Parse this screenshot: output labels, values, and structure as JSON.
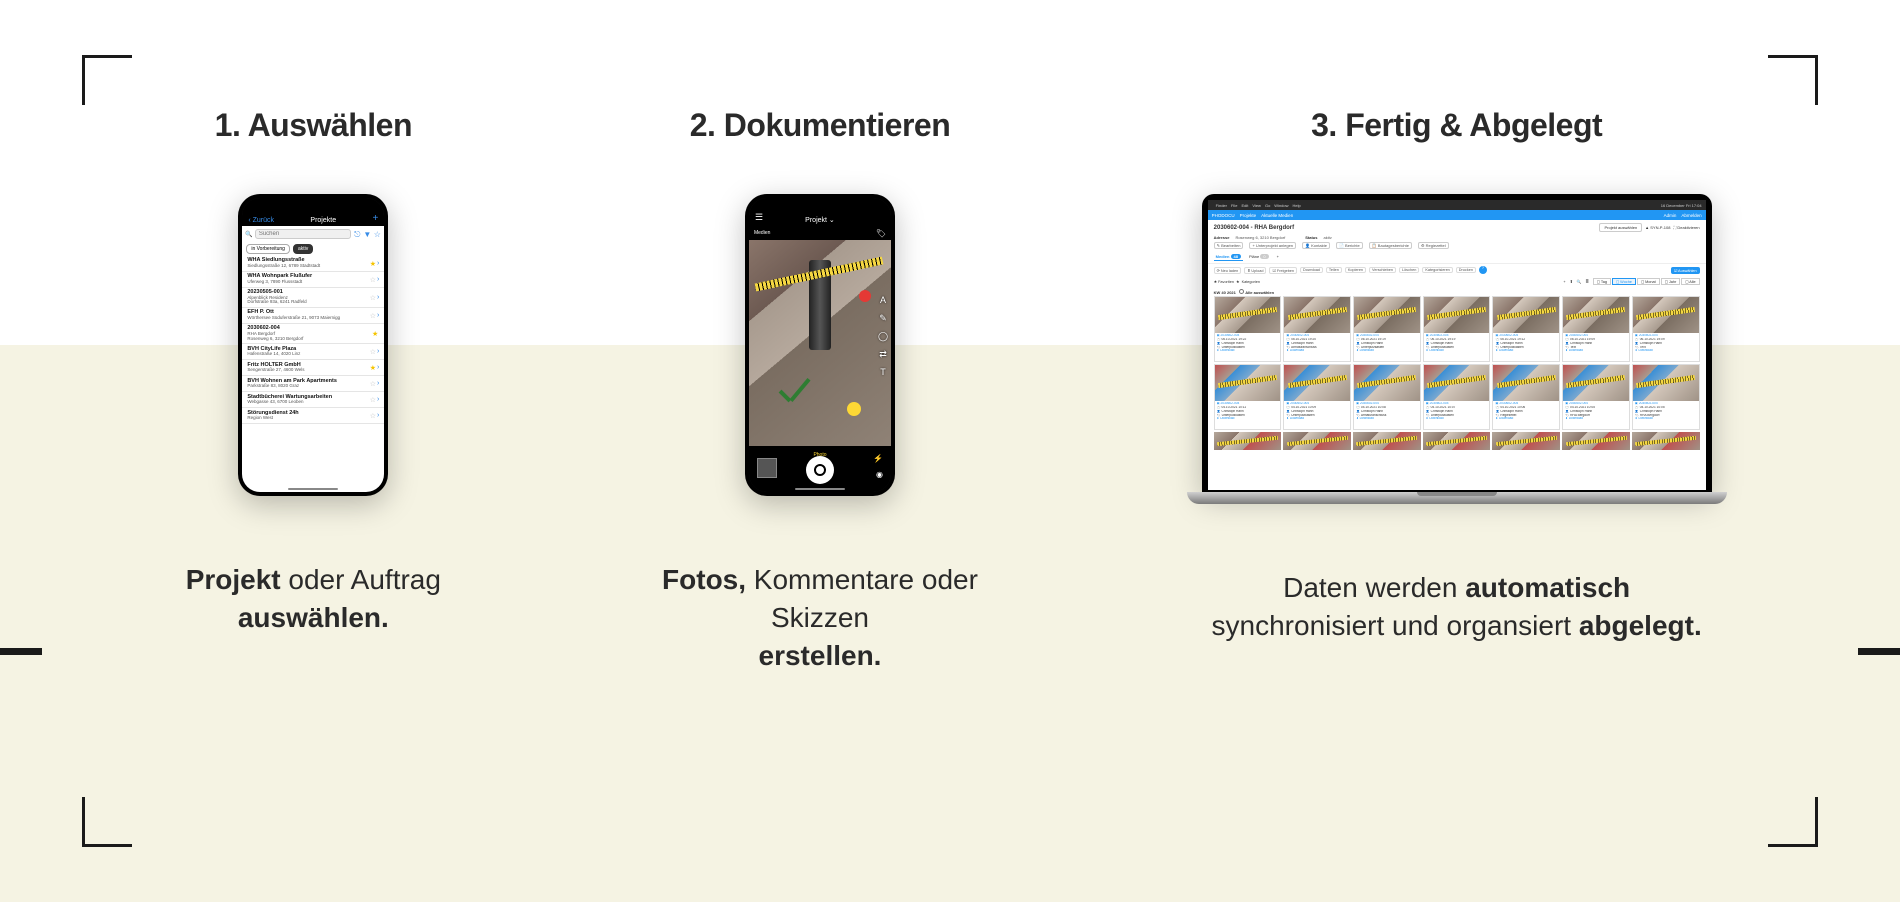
{
  "steps": {
    "s1": {
      "title": "1. Auswählen",
      "caption_bold1": "Projekt",
      "caption_plain1": " oder Auftrag ",
      "caption_bold2": "auswählen."
    },
    "s2": {
      "title": "2. Dokumentieren",
      "caption_bold1": "Fotos,",
      "caption_plain1": " Kommentare oder Skizzen ",
      "caption_bold2": "erstellen."
    },
    "s3": {
      "title": "3. Fertig & Abgelegt",
      "caption_plain1": "Daten werden ",
      "caption_bold1": "automatisch",
      "caption_plain2": " synchronisiert und organsiert ",
      "caption_bold2": "abgelegt."
    }
  },
  "phone1": {
    "back": "Zurück",
    "header_title": "Projekte",
    "plus": "+",
    "search_placeholder": "Suchen",
    "tabs": {
      "prep": "in Vorbereitung",
      "active": "aktiv"
    },
    "rows": [
      {
        "t1": "WHA Siedlungsstraße",
        "t2": "Siedlungsstraße 12, 6789 Stadtstadt",
        "star": true,
        "chev": true
      },
      {
        "t1": "WHA Wohnpark Flußufer",
        "t2": "Uferweg 3, 7890 Flussstadt",
        "star": false,
        "chev": true
      },
      {
        "t1": "20230505-001",
        "t2": "Alpenblick Residenz\nDorfstraße 93a, 6241 Radfeld",
        "star": false,
        "chev": true
      },
      {
        "t1": "EFH P. Ott",
        "t2": "Wörthersee Süduferstraße 21, 9073 Maiernigg",
        "star": false,
        "chev": true
      },
      {
        "t1": "2030602-004",
        "t2": "RHA Bergdorf\nRosenweg 6, 3210 Bergdorf",
        "star": true,
        "chev": false
      },
      {
        "t1": "BVH CityLife Plaza",
        "t2": "Hafenstraße 14, 4020 Linz",
        "star": false,
        "chev": true
      },
      {
        "t1": "Fritz HOLTER GmbH",
        "t2": "Sengerstraße 27, 4600 Wels",
        "star": true,
        "chev": true
      },
      {
        "t1": "BVH Wohnen am Park Apartments",
        "t2": "Parkstraße 83, 8020 Graz",
        "star": false,
        "chev": true
      },
      {
        "t1": "Stadtbücherei Wartungsarbeiten",
        "t2": "Webgasse 43, 6700 Leoben",
        "star": false,
        "chev": true
      },
      {
        "t1": "Störungsdienst 24h",
        "t2": "Region West",
        "star": false,
        "chev": true
      }
    ]
  },
  "phone2": {
    "header_title": "Projekt",
    "section_label": "Medien",
    "mode": "Photo",
    "tools": [
      "A",
      "✎",
      "◯",
      "⇄",
      "T"
    ]
  },
  "laptop": {
    "mac_menu_left": [
      "",
      "Finder",
      "File",
      "Edit",
      "View",
      "Go",
      "Window",
      "Help"
    ],
    "mac_menu_right": [
      "16 December Fri 17:04"
    ],
    "topbar_left": [
      "PHODOCU",
      "Projekte",
      "Aktuelle Medien"
    ],
    "topbar_right": [
      "Admin",
      "Abmelden"
    ],
    "project_title": "2030602-004 - RHA Bergdorf",
    "project_select": "Projekt auswählen",
    "project_meta1": "▲ SYN-P-108",
    "project_meta2": "⛶ Deaktivieren",
    "sub_label_addr": "Adresse",
    "sub_addr": "Rosenweg 6, 3210 Bergdorf",
    "sub_label_status": "Status",
    "sub_status": "aktiv",
    "sub_btns": [
      "✎ Bearbeiten",
      "+ Unterprojekt anlegen",
      "👤 Kontakte",
      "📄 Berichte",
      "📋 Bautagesberichte",
      "⚙ Regiezettel"
    ],
    "tab_media": "Medien",
    "tab_media_count": "48",
    "tab_plane": "Pläne",
    "tab_plane_count": "0",
    "tab_plus": "+",
    "actionbar": [
      "⟳ Neu laden",
      "⬆ Upload",
      "☑ Freigeben",
      "Download",
      "Teilen",
      "Kopieren",
      "Verschieben",
      "Löschen",
      "Kategorisieren",
      "Drucken"
    ],
    "actionbar_btn": "☑ Auswählen",
    "filter_star": "★",
    "filter_fav": "Favoriten",
    "filter_cat": "Kategorien",
    "filter_modes": [
      "Tag",
      "Woche",
      "Monat",
      "Jahr",
      "Alle"
    ],
    "kw_label": "KW 40 2021",
    "kw_check": "Alle auswählen",
    "card_proj": "▣ 2030602-004",
    "card_date": "🕐 06.10.2021 19:22",
    "card_user": "👤 Christoph Hahn",
    "card_note1": "🏷 Unterputzkasten",
    "card_note2": "🏷 Armaturanschluss",
    "card_note3": "🏷 RHA Bergdorf",
    "card_note4": "🏷 Regiezettel",
    "card_note_gen": "🏷 Text",
    "card_dl": "⬇ Download",
    "card_dates": [
      "06.10.2021 19:22",
      "06.10.2021 19:20",
      "06.10.2021 19:19",
      "06.10.2021 19:19",
      "06.10.2021 19:12",
      "06.10.2021 19:09",
      "06.10.2021 19:09",
      "04.10.2021 10:11",
      "04.10.2021 10:09",
      "04.10.2021 10:08",
      "04.10.2021 10:07",
      "04.10.2021 10:06",
      "04.10.2021 10:05",
      "04.10.2021 10:05"
    ]
  }
}
